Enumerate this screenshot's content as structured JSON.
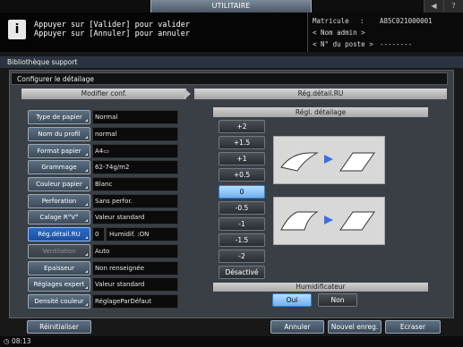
{
  "header": {
    "tab_title": "UTILITAIRE",
    "icons": [
      "speaker-icon",
      "help-icon"
    ],
    "message_line1": "Appuyer sur [Valider] pour valider",
    "message_line2": "Appuyer sur [Annuler] pour annuler",
    "matricule_label": "Matricule",
    "matricule_sep": ":",
    "matricule_value": "A85C021000001",
    "admin_label": "< Nom admin >",
    "poste_label": "< N° du poste >",
    "poste_value": "--------"
  },
  "breadcrumb": {
    "level1": "Bibliothèque support",
    "level2": "Configurer le détailage"
  },
  "left": {
    "title": "Modifier conf.",
    "rows": [
      {
        "label": "Type de papier",
        "value": "Normal"
      },
      {
        "label": "Nom du profil",
        "value": "normal"
      },
      {
        "label": "Format papier",
        "value": "A4▭"
      },
      {
        "label": "Grammage",
        "value": "62-74g/m2"
      },
      {
        "label": "Couleur papier",
        "value": "Blanc"
      },
      {
        "label": "Perforation",
        "value": "Sans perfor."
      },
      {
        "label": "Calage R°V°",
        "value": "Valeur standard"
      },
      {
        "label": "Rég.détail.RU",
        "value": "0",
        "value2": "Humidif.  :ON"
      },
      {
        "label": "Ventilation",
        "value": "Auto"
      },
      {
        "label": "Epaisseur",
        "value": "Non renseignée"
      },
      {
        "label": "Réglages expert",
        "value": "Valeur standard"
      },
      {
        "label": "Densité couleur",
        "value": "RéglageParDéfaut"
      }
    ]
  },
  "right": {
    "title": "Rég.détail.RU",
    "reg_title": "Régl. détailage",
    "levels": [
      "+2",
      "+1.5",
      "+1",
      "+0.5",
      "0",
      "-0.5",
      "-1",
      "-1.5",
      "-2",
      "Désactivé"
    ],
    "selected_level": "0",
    "hum_title": "Humidificateur",
    "hum_on": "Oui",
    "hum_off": "Non"
  },
  "footer": {
    "reset": "Réinitialiser",
    "cancel": "Annuler",
    "new_save": "Nouvel enreg.",
    "overwrite": "Ecraser",
    "time": "08:13"
  }
}
